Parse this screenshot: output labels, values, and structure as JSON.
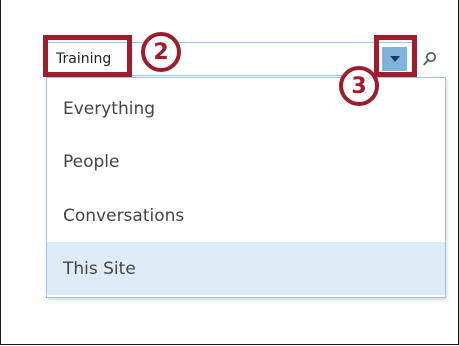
{
  "search": {
    "query": "Training",
    "scope_button_icon": "chevron-down-icon",
    "search_icon": "search-icon"
  },
  "scope_menu": {
    "items": [
      {
        "label": "Everything",
        "selected": false
      },
      {
        "label": "People",
        "selected": false
      },
      {
        "label": "Conversations",
        "selected": false
      },
      {
        "label": "This Site",
        "selected": true
      }
    ]
  },
  "annotations": {
    "callout_2": "2",
    "callout_3": "3",
    "color": "#a01c2a"
  },
  "colors": {
    "accent_border": "#9cc3e6",
    "dropdown_button": "#7fb2dc",
    "selected_row": "#deecf8"
  }
}
